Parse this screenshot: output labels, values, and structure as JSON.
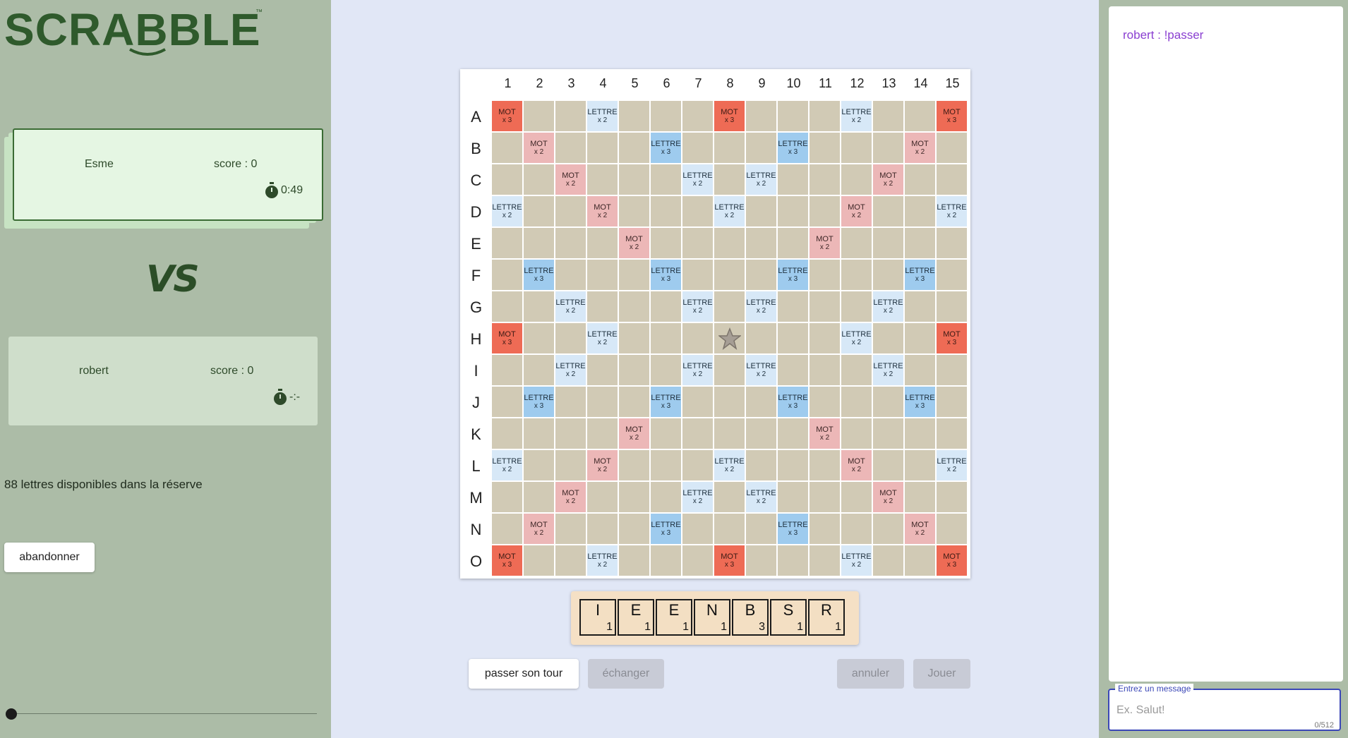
{
  "app": {
    "logo_text": "SCRABBLE",
    "logo_mark": "™"
  },
  "players": [
    {
      "name": "Esme",
      "score": "score : 0",
      "timer": "0:49",
      "active": true
    },
    {
      "name": "robert",
      "score": "score : 0",
      "timer": "-:-",
      "active": false
    }
  ],
  "vs_label": "VS",
  "reserve_text": "88 lettres disponibles dans la réserve",
  "abandon_label": "abandonner",
  "board": {
    "columns": [
      "1",
      "2",
      "3",
      "4",
      "5",
      "6",
      "7",
      "8",
      "9",
      "10",
      "11",
      "12",
      "13",
      "14",
      "15"
    ],
    "rows": [
      "A",
      "B",
      "C",
      "D",
      "E",
      "F",
      "G",
      "H",
      "I",
      "J",
      "K",
      "L",
      "M",
      "N",
      "O"
    ],
    "bonus_labels": {
      "tw": [
        "MOT",
        "x 3"
      ],
      "dw": [
        "MOT",
        "x 2"
      ],
      "tl": [
        "LETTRE",
        "x 3"
      ],
      "dl": [
        "LETTRE",
        "x 2"
      ]
    },
    "layout": [
      "T..d...T...d..T",
      ".D...t...t...D.",
      "..D...d.d...D..",
      "d..D...d...D..d",
      "....D.....D....",
      ".t...t...t...t.",
      "..d...d.d...d..",
      "T..d...*...d..T",
      "..d...d.d...d..",
      ".t...t...t...t.",
      "....D.....D....",
      "d..D...d...D..d",
      "..D...d.d...D..",
      ".D...t...t...D.",
      "T..d...T...d..T"
    ],
    "colors": {
      "tw": "#ee6b55",
      "dw": "#ecb7b7",
      "tl": "#9ecbee",
      "dl": "#d7e8f7",
      "plain": "#d1cab5"
    }
  },
  "rack": [
    {
      "letter": "I",
      "points": "1"
    },
    {
      "letter": "E",
      "points": "1"
    },
    {
      "letter": "E",
      "points": "1"
    },
    {
      "letter": "N",
      "points": "1"
    },
    {
      "letter": "B",
      "points": "3"
    },
    {
      "letter": "S",
      "points": "1"
    },
    {
      "letter": "R",
      "points": "1"
    }
  ],
  "actions": {
    "pass": "passer son tour",
    "exchange": "échanger",
    "cancel": "annuler",
    "play": "Jouer"
  },
  "chat": {
    "messages": [
      "robert : !passer"
    ],
    "input_label": "Entrez un message",
    "input_placeholder": "Ex. Salut!",
    "counter": "0/512"
  }
}
